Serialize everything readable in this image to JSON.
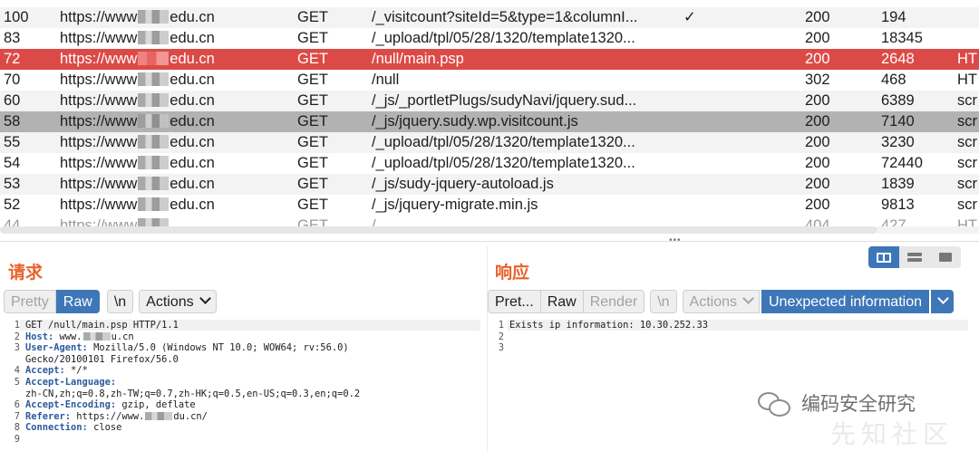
{
  "history": {
    "rows": [
      {
        "num": "100",
        "host_prefix": "https://www",
        "host_suffix": "edu.cn",
        "method": "GET",
        "url": "/_visitcount?siteId=5&type=1&columnI...",
        "params": "✓",
        "status": "200",
        "length": "194",
        "mime": ""
      },
      {
        "num": "83",
        "host_prefix": "https://www",
        "host_suffix": "edu.cn",
        "method": "GET",
        "url": "/_upload/tpl/05/28/1320/template1320...",
        "params": "",
        "status": "200",
        "length": "18345",
        "mime": ""
      },
      {
        "num": "72",
        "host_prefix": "https://www",
        "host_suffix": "edu.cn",
        "method": "GET",
        "url": "/null/main.psp",
        "params": "",
        "status": "200",
        "length": "2648",
        "mime": "HT"
      },
      {
        "num": "70",
        "host_prefix": "https://www",
        "host_suffix": "edu.cn",
        "method": "GET",
        "url": "/null",
        "params": "",
        "status": "302",
        "length": "468",
        "mime": "HT"
      },
      {
        "num": "60",
        "host_prefix": "https://www",
        "host_suffix": "edu.cn",
        "method": "GET",
        "url": "/_js/_portletPlugs/sudyNavi/jquery.sud...",
        "params": "",
        "status": "200",
        "length": "6389",
        "mime": "scr"
      },
      {
        "num": "58",
        "host_prefix": "https://www",
        "host_suffix": "edu.cn",
        "method": "GET",
        "url": "/_js/jquery.sudy.wp.visitcount.js",
        "params": "",
        "status": "200",
        "length": "7140",
        "mime": "scr"
      },
      {
        "num": "55",
        "host_prefix": "https://www",
        "host_suffix": "edu.cn",
        "method": "GET",
        "url": "/_upload/tpl/05/28/1320/template1320...",
        "params": "",
        "status": "200",
        "length": "3230",
        "mime": "scr"
      },
      {
        "num": "54",
        "host_prefix": "https://www",
        "host_suffix": "edu.cn",
        "method": "GET",
        "url": "/_upload/tpl/05/28/1320/template1320...",
        "params": "",
        "status": "200",
        "length": "72440",
        "mime": "scr"
      },
      {
        "num": "53",
        "host_prefix": "https://www",
        "host_suffix": "edu.cn",
        "method": "GET",
        "url": "/_js/sudy-jquery-autoload.js",
        "params": "",
        "status": "200",
        "length": "1839",
        "mime": "scr"
      },
      {
        "num": "52",
        "host_prefix": "https://www",
        "host_suffix": "edu.cn",
        "method": "GET",
        "url": "/_js/jquery-migrate.min.js",
        "params": "",
        "status": "200",
        "length": "9813",
        "mime": "scr"
      },
      {
        "num": "44",
        "host_prefix": "https://www",
        "host_suffix": "",
        "method": "GET",
        "url": "/_",
        "params": "",
        "status": "404",
        "length": "427",
        "mime": "HT"
      }
    ]
  },
  "request": {
    "title": "请求",
    "tabs": {
      "pretty": "Pretty",
      "raw": "Raw",
      "newline": "\\n",
      "actions": "Actions"
    },
    "lines": [
      {
        "n": "1",
        "key": "",
        "val": "GET /null/main.psp HTTP/1.1"
      },
      {
        "n": "2",
        "key": "Host:",
        "val": " www.",
        "val2": "u.cn"
      },
      {
        "n": "3",
        "key": "User-Agent:",
        "val": " Mozilla/5.0 (Windows NT 10.0; WOW64; rv:56.0)"
      },
      {
        "n": "",
        "key": "",
        "val": "Gecko/20100101 Firefox/56.0"
      },
      {
        "n": "4",
        "key": "Accept:",
        "val": " */*"
      },
      {
        "n": "5",
        "key": "Accept-Language:",
        "val": ""
      },
      {
        "n": "",
        "key": "",
        "val": "zh-CN,zh;q=0.8,zh-TW;q=0.7,zh-HK;q=0.5,en-US;q=0.3,en;q=0.2"
      },
      {
        "n": "6",
        "key": "Accept-Encoding:",
        "val": " gzip, deflate"
      },
      {
        "n": "7",
        "key": "Referer:",
        "val": " https://www.",
        "val2": "du.cn/"
      },
      {
        "n": "8",
        "key": "Connection:",
        "val": " close"
      },
      {
        "n": "9",
        "key": "",
        "val": ""
      }
    ]
  },
  "response": {
    "title": "响应",
    "tabs": {
      "pretty": "Pret...",
      "raw": "Raw",
      "render": "Render",
      "newline": "\\n",
      "actions": "Actions",
      "extension": "Unexpected information"
    },
    "lines": [
      {
        "n": "1",
        "val": "Exists ip information: 10.30.252.33"
      },
      {
        "n": "2",
        "val": ""
      },
      {
        "n": "3",
        "val": ""
      }
    ]
  },
  "watermark": {
    "text": "编码安全研究",
    "ghost": "先知社区"
  },
  "colors": {
    "accent": "#e8632c",
    "selected_red": "#dc4a47",
    "selected_gray": "#b2b2b2",
    "blue": "#3e77b8"
  }
}
